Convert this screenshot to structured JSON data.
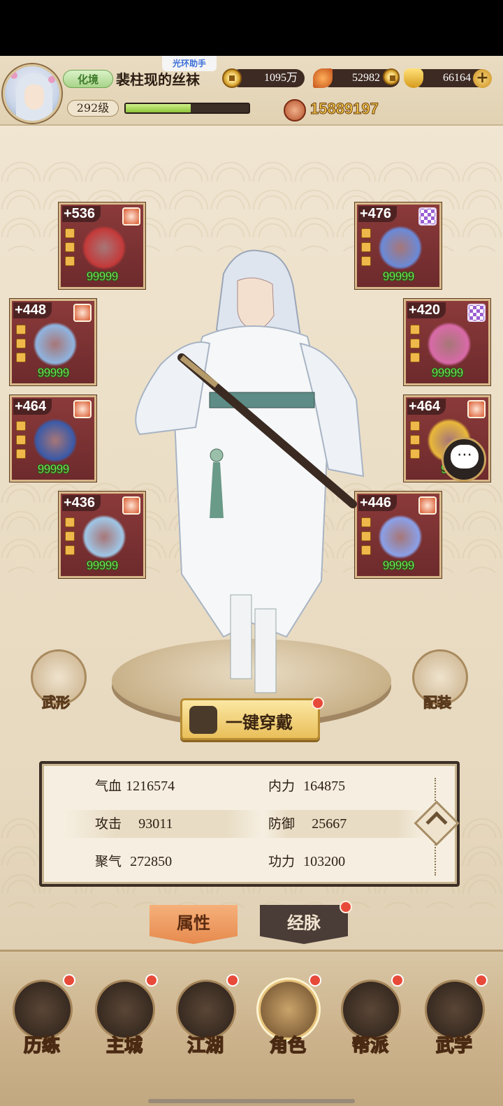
{
  "header": {
    "helper_tag": "光环助手",
    "realm": "化境",
    "player_name": "裴柱现的丝袜",
    "copper": "1095万",
    "leaf_currency": "52982",
    "gold": "66164",
    "level": "292级",
    "exp_fraction": 0.53,
    "power": "15889197"
  },
  "equipment": {
    "left": [
      {
        "plus": "+536",
        "grade": "red",
        "stars": "99999",
        "item": "sword-icon"
      },
      {
        "plus": "+448",
        "grade": "red",
        "stars": "99999",
        "item": "robe-icon"
      },
      {
        "plus": "+464",
        "grade": "red",
        "stars": "99999",
        "item": "belt-icon"
      },
      {
        "plus": "+436",
        "grade": "red",
        "stars": "99999",
        "item": "boots-icon"
      }
    ],
    "right": [
      {
        "plus": "+476",
        "grade": "purple",
        "stars": "99999",
        "item": "necklace-icon"
      },
      {
        "plus": "+420",
        "grade": "purple",
        "stars": "99999",
        "item": "pendant-icon"
      },
      {
        "plus": "+464",
        "grade": "red",
        "stars": "99",
        "item": "bracelet-icon"
      },
      {
        "plus": "+446",
        "grade": "red",
        "stars": "99999",
        "item": "ring-icon"
      }
    ]
  },
  "actions": {
    "wuxing": "武形",
    "peizhuang": "配装",
    "one_click_wear": "一键穿戴"
  },
  "stats": {
    "hp_label": "气血",
    "hp": "1216574",
    "neili_label": "内力",
    "neili": "164875",
    "atk_label": "攻击",
    "atk": "93011",
    "def_label": "防御",
    "def": "25667",
    "juqi_label": "聚气",
    "juqi": "272850",
    "gongli_label": "功力",
    "gongli": "103200"
  },
  "tabs": {
    "attributes": "属性",
    "meridians": "经脉"
  },
  "nav": [
    {
      "label": "历练",
      "active": false
    },
    {
      "label": "主城",
      "active": false
    },
    {
      "label": "江湖",
      "active": false
    },
    {
      "label": "角色",
      "active": true
    },
    {
      "label": "帮派",
      "active": false
    },
    {
      "label": "武学",
      "active": false
    }
  ],
  "colors": {
    "accent_gold": "#f3c94a",
    "slot_red": "#8b3a3a",
    "star_green": "#7be05a",
    "notification_red": "#e84a3a"
  }
}
